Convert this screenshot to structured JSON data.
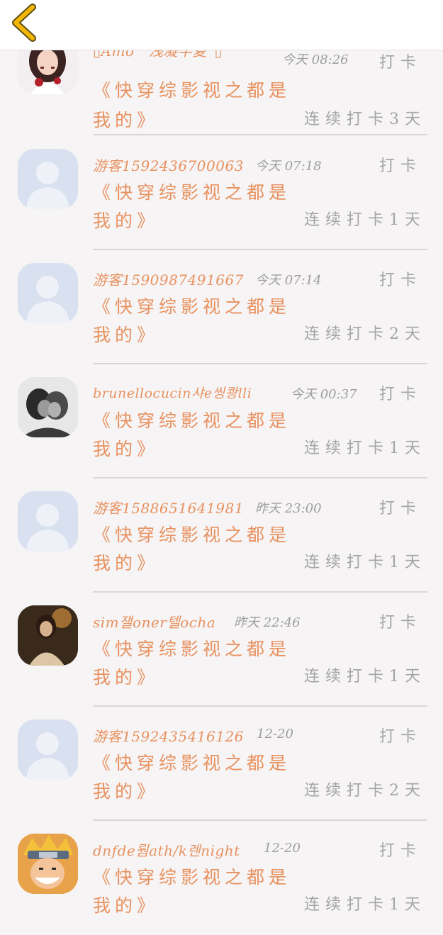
{
  "header": {
    "back_icon": "chevron-left-icon",
    "accent": "#f2b705"
  },
  "colors": {
    "accent_text": "#e89260",
    "muted_text": "#9e9e9e",
    "background": "#f6f4f5"
  },
  "records": [
    {
      "user": "▯Amo　浅凝半夏ˇ▯",
      "time": "今天 08:26",
      "checkin_label": "打卡",
      "book_line1": "《快穿综影视之都是",
      "book_line2": "我的》",
      "streak": "连续打卡3天",
      "avatar": "photo-girl-red"
    },
    {
      "user": "游客1592436700063",
      "time": "今天 07:18",
      "checkin_label": "打卡",
      "book_line1": "《快穿综影视之都是",
      "book_line2": "我的》",
      "streak": "连续打卡1天",
      "avatar": "default"
    },
    {
      "user": "游客1590987491667",
      "time": "今天 07:14",
      "checkin_label": "打卡",
      "book_line1": "《快穿综影视之都是",
      "book_line2": "我的》",
      "streak": "连续打卡2天",
      "avatar": "default"
    },
    {
      "user": "brunellocucin샤e씽쾅lli",
      "time": "今天 00:37",
      "checkin_label": "打卡",
      "book_line1": "《快穿综影视之都是",
      "book_line2": "我的》",
      "streak": "连续打卡1天",
      "avatar": "photo-couple"
    },
    {
      "user": "游客1588651641981",
      "time": "昨天 23:00",
      "checkin_label": "打卡",
      "book_line1": "《快穿综影视之都是",
      "book_line2": "我的》",
      "streak": "连续打卡1天",
      "avatar": "default"
    },
    {
      "user": "sim잴oner텔ocha",
      "time": "昨天 22:46",
      "checkin_label": "打卡",
      "book_line1": "《快穿综影视之都是",
      "book_line2": "我的》",
      "streak": "连续打卡1天",
      "avatar": "photo-woman"
    },
    {
      "user": "游客1592435416126",
      "time": "12-20",
      "checkin_label": "打卡",
      "book_line1": "《快穿综影视之都是",
      "book_line2": "我的》",
      "streak": "连续打卡2天",
      "avatar": "default"
    },
    {
      "user": "dnfde뤔ath/k렌night",
      "time": "12-20",
      "checkin_label": "打卡",
      "book_line1": "《快穿综影视之都是",
      "book_line2": "我的》",
      "streak": "连续打卡1天",
      "avatar": "photo-anime"
    }
  ]
}
